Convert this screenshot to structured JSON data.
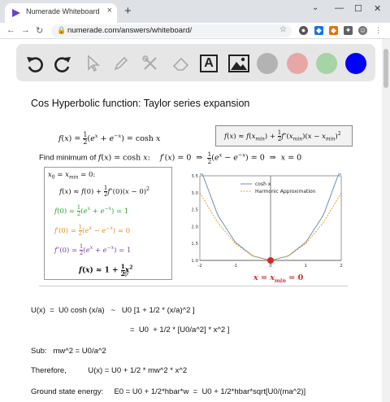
{
  "browser": {
    "tab_title": "Numerade Whiteboard",
    "tab_close": "×",
    "new_tab": "+",
    "url": "numerade.com/answers/whiteboard/",
    "window_buttons": [
      "⌄",
      "—",
      "☐",
      "✕"
    ]
  },
  "colors": {
    "swatch_gray": "#b3b3b3",
    "swatch_pink": "#e8a7a7",
    "swatch_green": "#a7d3a7",
    "swatch_blue": "#0000ff",
    "green": "#2ca02c",
    "orange": "#e08a1e",
    "purple": "#7b3fa0",
    "red": "#d62728"
  },
  "toolbar": {
    "tools": [
      "undo-icon",
      "redo-icon",
      "pointer-icon",
      "pen-icon",
      "tools-icon",
      "eraser-icon",
      "text-icon",
      "image-icon"
    ],
    "text_tool_glyph": "A"
  },
  "board": {
    "title": "Cos Hyperbolic function: Taylor series expansion",
    "eq1_lhs": "f(x) = ",
    "eq1_half": "1/2",
    "eq1_rhs": "(e",
    "eq1_tail": " = cosh x",
    "taylor_box": "f(x) ≈ f(x",
    "find_min": "Find minimum of ",
    "find_min_fx": "f(x) = cosh x:",
    "find_min_cond": "f′(x) = 0  ⇒  ½(e",
    "find_min_end": ") = 0  ⇒  x = 0",
    "deriv": {
      "line0": "x",
      "line1": "f(x) ≈ f(0) + ½ f″(0)(x − 0)²",
      "line2": "f(0) = ½(e",
      "line3": "f′(0) = ½(e",
      "line4": "f″(0) = ½(e",
      "line5": "f(x) ≈ 1 + ½ x²"
    },
    "plot": {
      "min_label": "x = x"
    },
    "text_lines": [
      "U(x)  =  U0 cosh (x/a)   ~   U0 [1 + 1/2 * (x/a)^2 ]",
      "=  U0  + 1/2 * [U0/a^2] * x^2 ]",
      "Sub:   mw^2 = U0/a^2",
      "Therefore,          U(x) = U0 + 1/2 * mw^2 * x^2",
      "Ground state energy:     E0 = U0 + 1/2*hbar*w  =  U0 + 1/2*hbar*sqrt[U0/(ma^2)]"
    ]
  },
  "chart_data": {
    "type": "line",
    "title": "",
    "xlabel": "",
    "ylabel": "",
    "xlim": [
      -2,
      2
    ],
    "ylim": [
      1.0,
      3.5
    ],
    "x_ticks": [
      "-2",
      "-1",
      "0",
      "1",
      "2"
    ],
    "y_ticks": [
      "1.0",
      "1.5",
      "2.0",
      "2.5",
      "3.0",
      "3.5"
    ],
    "legend": "top-left",
    "series": [
      {
        "name": "cosh x",
        "color": "#6a8fb8",
        "style": "solid",
        "x": [
          -2,
          -1.5,
          -1,
          -0.5,
          0,
          0.5,
          1,
          1.5,
          2
        ],
        "y": [
          3.76,
          2.35,
          1.54,
          1.13,
          1.0,
          1.13,
          1.54,
          2.35,
          3.76
        ]
      },
      {
        "name": "Harmonic Approximation",
        "color": "#e0a030",
        "style": "dashed",
        "x": [
          -2,
          -1.5,
          -1,
          -0.5,
          0,
          0.5,
          1,
          1.5,
          2
        ],
        "y": [
          3.0,
          2.125,
          1.5,
          1.125,
          1.0,
          1.125,
          1.5,
          2.125,
          3.0
        ]
      }
    ],
    "minimum_point": {
      "x": 0,
      "y": 1.0
    }
  }
}
